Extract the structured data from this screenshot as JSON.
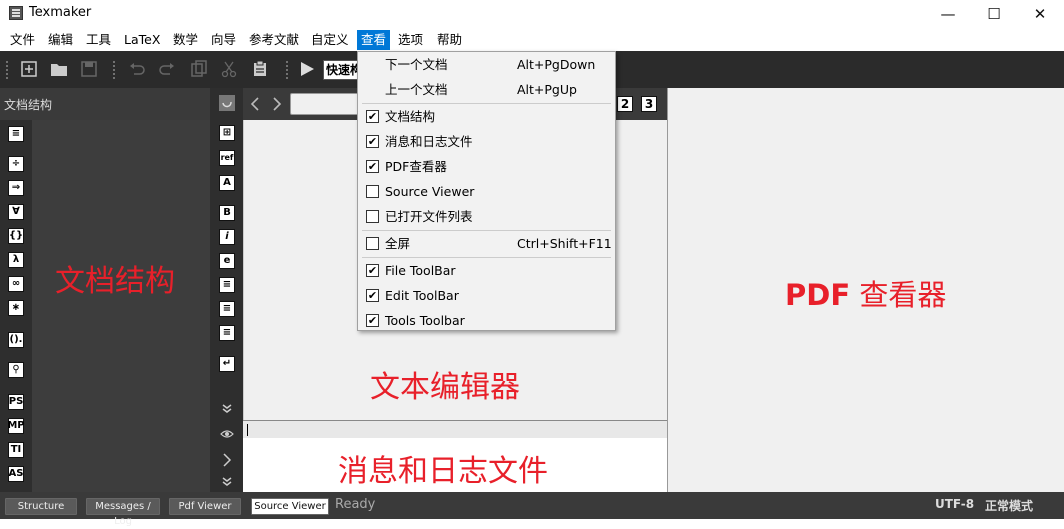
{
  "window": {
    "title": "Texmaker",
    "minimize_glyph": "—",
    "maximize_glyph": "☐",
    "close_glyph": "✕"
  },
  "menubar": {
    "items": [
      "文件",
      "编辑",
      "工具",
      "LaTeX",
      "数学",
      "向导",
      "参考文献",
      "自定义",
      "查看",
      "选项",
      "帮助"
    ],
    "active": "查看"
  },
  "toolbar": {
    "quick_build_label": "快速构建"
  },
  "structure_panel": {
    "title": "文档结构",
    "overlay_label": "文档结构",
    "left_icons": [
      "≡",
      "÷",
      "⇒",
      "∀",
      "{}",
      "λ",
      "∞",
      "∗",
      "().",
      "⚲",
      "PS",
      "MP",
      "TI",
      "AS"
    ],
    "right_icons": [
      "⊞",
      "ref",
      "A",
      "B",
      "i",
      "e",
      "≡",
      "≡",
      "≡",
      "↵"
    ]
  },
  "editor": {
    "overlay_label": "文本编辑器",
    "log_label": "消息和日志文件"
  },
  "pdf_viewer": {
    "overlay_bold": "PDF",
    "overlay_rest": "查看器",
    "page_buttons": [
      "2",
      "3"
    ]
  },
  "view_menu": {
    "items": [
      {
        "label": "下一个文档",
        "shortcut": "Alt+PgDown",
        "checkable": false
      },
      {
        "label": "上一个文档",
        "shortcut": "Alt+PgUp",
        "checkable": false
      },
      {
        "label": "文档结构",
        "checked": true
      },
      {
        "label": "消息和日志文件",
        "checked": true
      },
      {
        "label": "PDF查看器",
        "checked": true
      },
      {
        "label": "Source Viewer",
        "checked": false
      },
      {
        "label": "已打开文件列表",
        "checked": false
      },
      {
        "label": "全屏",
        "shortcut": "Ctrl+Shift+F11",
        "checked": false
      },
      {
        "label": "File ToolBar",
        "checked": true
      },
      {
        "label": "Edit ToolBar",
        "checked": true
      },
      {
        "label": "Tools Toolbar",
        "checked": true
      }
    ],
    "check_glyph": "✔"
  },
  "statusbar": {
    "tabs": [
      "Structure",
      "Messages / Log",
      "Pdf Viewer",
      "Source Viewer"
    ],
    "active_tab": "Source Viewer",
    "status": "Ready",
    "encoding": "UTF-8",
    "mode": "正常模式"
  }
}
